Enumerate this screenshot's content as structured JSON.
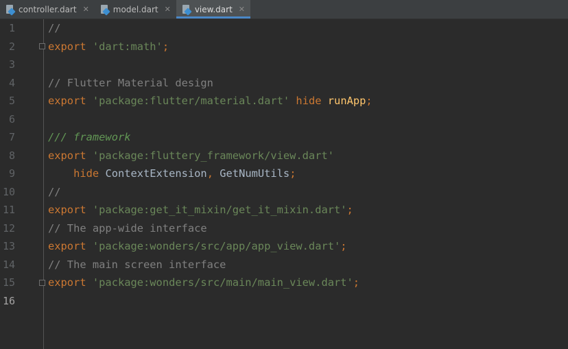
{
  "tabs": [
    {
      "label": "controller.dart",
      "active": false
    },
    {
      "label": "model.dart",
      "active": false
    },
    {
      "label": "view.dart",
      "active": true
    }
  ],
  "line_numbers": [
    "1",
    "2",
    "3",
    "4",
    "5",
    "6",
    "7",
    "8",
    "9",
    "10",
    "11",
    "12",
    "13",
    "14",
    "15",
    "16"
  ],
  "current_line": "16",
  "code": {
    "l1": {
      "comment": "//"
    },
    "l2": {
      "kw": "export",
      "str": "'dart:math'",
      "semi": ";"
    },
    "l4": {
      "comment": "// Flutter Material design"
    },
    "l5": {
      "kw": "export",
      "str": "'package:flutter/material.dart'",
      "kw2": "hide",
      "fn": "runApp",
      "semi": ";"
    },
    "l7": {
      "doc_slashes": "///",
      "doc_word": "framework"
    },
    "l8": {
      "kw": "export",
      "str": "'package:fluttery_framework/view.dart'"
    },
    "l9": {
      "kw": "hide",
      "ident1": "ContextExtension",
      "comma": ",",
      "ident2": "GetNumUtils",
      "semi": ";"
    },
    "l10": {
      "comment": "//"
    },
    "l11": {
      "kw": "export",
      "str": "'package:get_it_mixin/get_it_mixin.dart'",
      "semi": ";"
    },
    "l12": {
      "comment": "// The app-wide interface"
    },
    "l13": {
      "kw": "export",
      "str": "'package:wonders/src/app/app_view.dart'",
      "semi": ";"
    },
    "l14": {
      "comment": "// The main screen interface"
    },
    "l15": {
      "kw": "export",
      "str": "'package:wonders/src/main/main_view.dart'",
      "semi": ";"
    }
  },
  "colors": {
    "background": "#2b2b2b",
    "keyword": "#cc7832",
    "string": "#6a8759",
    "comment": "#808080",
    "doc_comment": "#629755",
    "function": "#ffc66d",
    "identifier": "#a9b7c6",
    "tab_accent": "#4a88c7"
  },
  "icons": {
    "tab_file": "dart-file-icon",
    "tab_close": "close-icon",
    "fold": "fold-marker-icon"
  }
}
